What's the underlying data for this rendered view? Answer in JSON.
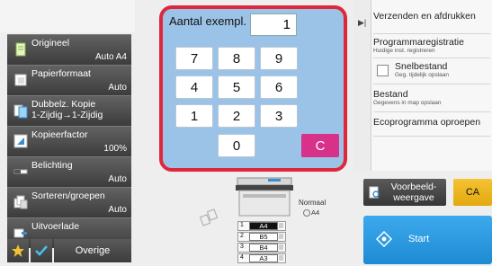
{
  "left_panel": {
    "items": [
      {
        "label": "Origineel",
        "value": "Auto  A4",
        "icon": "original-doc-icon"
      },
      {
        "label": "Papierformaat",
        "value": "Auto",
        "icon": "paper-size-icon"
      },
      {
        "label": "Dubbelz. Kopie",
        "label2": "1-Zijdig→1-Zijdig",
        "value": "",
        "icon": "duplex-copy-icon"
      },
      {
        "label": "Kopieerfactor",
        "value": "100%",
        "icon": "zoom-icon"
      },
      {
        "label": "Belichting",
        "value": "Auto",
        "icon": "exposure-icon"
      },
      {
        "label": "Sorteren/groepen",
        "value": "Auto",
        "icon": "sort-group-icon"
      },
      {
        "label": "Uitvoerlade",
        "value": "",
        "icon": "output-tray-icon"
      }
    ],
    "bottom": {
      "overige_label": "Overige"
    }
  },
  "keypad": {
    "label": "Aantal exempl.",
    "value": "1",
    "keys": [
      "7",
      "8",
      "9",
      "4",
      "5",
      "6",
      "1",
      "2",
      "3",
      "0"
    ],
    "clear_label": "C"
  },
  "right_panel": {
    "send_print": "Verzenden en afdrukken",
    "program_reg": "Programmaregistratie",
    "program_reg_sub": "Huidige inst. registreren",
    "quick_file": "Snelbestand",
    "quick_file_sub": "Geg. tijdelijk opslaan",
    "file": "Bestand",
    "file_sub": "Gegevens in map opslaan",
    "eco": "Ecoprogramma oproepen"
  },
  "machine": {
    "output_mode": "Normaal",
    "output_size": "A4",
    "trays": [
      {
        "num": "1",
        "size": "A4",
        "selected": true
      },
      {
        "num": "2",
        "size": "B5",
        "selected": false
      },
      {
        "num": "3",
        "size": "B4",
        "selected": false
      },
      {
        "num": "4",
        "size": "A3",
        "selected": false
      }
    ]
  },
  "actions": {
    "preview_label1": "Voorbeeld-",
    "preview_label2": "weergave",
    "ca_label": "CA",
    "start_label": "Start"
  },
  "colors": {
    "keypad_bg": "#9bc3e8",
    "keypad_border": "#e0273a",
    "clear_key": "#d7318a",
    "ca_button": "#f4c233",
    "start_button": "#1e8ad3",
    "function_button": "#4a4a4a"
  }
}
